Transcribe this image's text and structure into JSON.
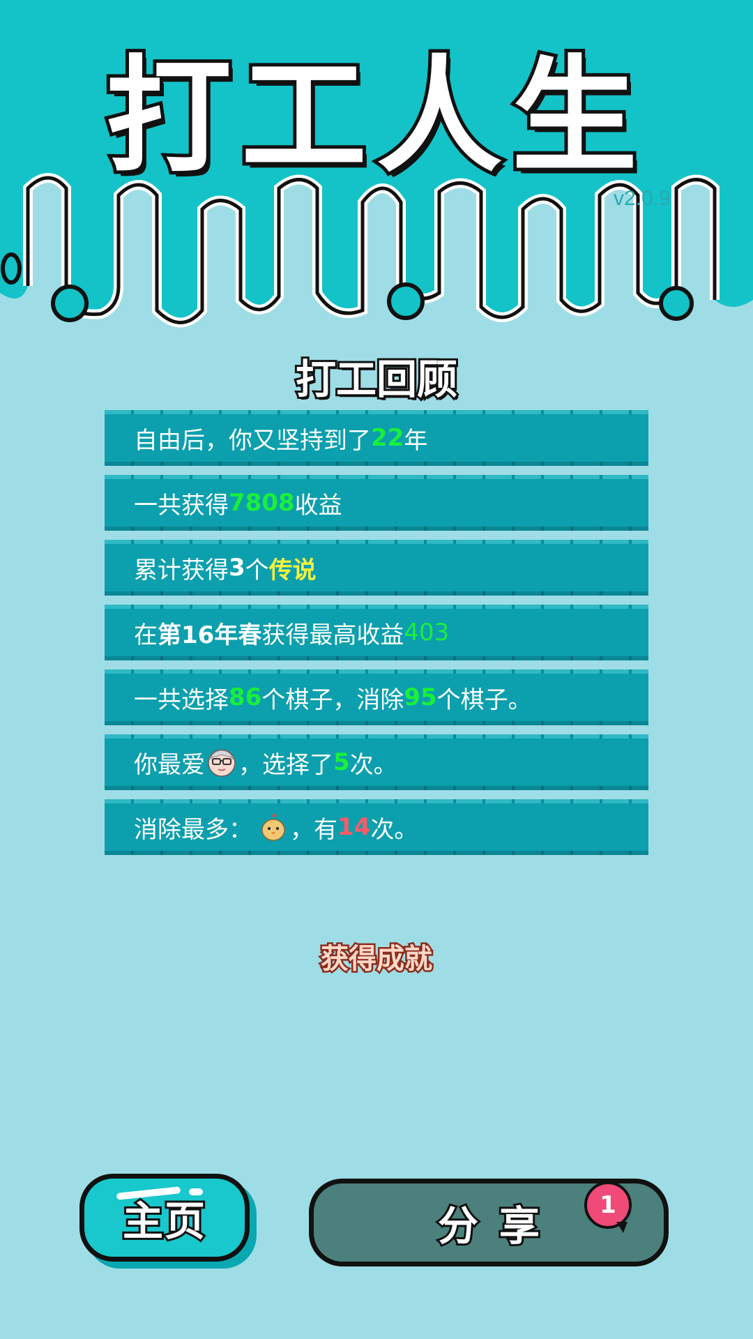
{
  "header": {
    "title": "打工人生",
    "version": "v2.0.9"
  },
  "review": {
    "title": "打工回顾",
    "rows": [
      {
        "text1": "自由后，你又坚持到了",
        "value": "22",
        "text2": "年"
      },
      {
        "text1": "一共获得",
        "value": "7808",
        "text2": "收益"
      },
      {
        "text1": "累计获得",
        "count": "3",
        "text2": "个",
        "rarity": "传说"
      },
      {
        "text1": "在 ",
        "season": "第16年春",
        "text2": " 获得最高收益",
        "value": "403"
      },
      {
        "text1": "一共选择",
        "value1": "86",
        "text2": "个棋子，消除",
        "value2": "95",
        "text3": "个棋子。"
      },
      {
        "text1": "你最爱",
        "icon": "old-man-face-icon",
        "text2": "，选择了",
        "value": "5",
        "text3": "次。"
      },
      {
        "text1": "消除最多：",
        "icon": "chick-icon",
        "text2": "，有",
        "value": "14",
        "text3": "次。"
      }
    ]
  },
  "achievement": {
    "label": "获得成就"
  },
  "buttons": {
    "home": "主页",
    "share": "分享",
    "share_badge": "1"
  },
  "colors": {
    "header_teal": "#13c3c8",
    "background": "#9fdde6",
    "row_bg": "#0c9fae",
    "highlight_green": "#19f03a",
    "highlight_yellow": "#f7f23c",
    "highlight_red": "#ff5a66",
    "share_button": "#4c807c",
    "badge": "#f04a78"
  }
}
